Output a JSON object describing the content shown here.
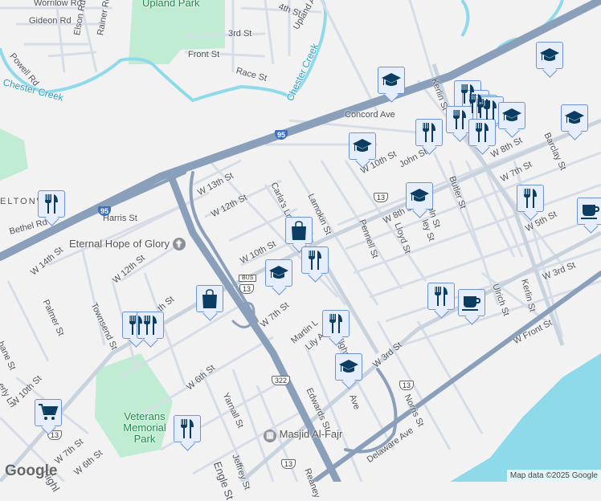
{
  "labels": {
    "worrilow": "Worrilow Rd",
    "gideon": "Gideon Rd",
    "elson": "Elson Rd",
    "rainer": "Rainer Rd",
    "powell": "Powell Rd",
    "upland_park": "Upland Park",
    "st4": "4th St",
    "upland_ave": "Upland Ave",
    "st3": "3rd St",
    "front": "Front St",
    "race": "Race St",
    "chester_creek_w": "Chester Creek",
    "chester_creek_e": "Chester Creek",
    "kerlin_n": "Kerlin St",
    "concord": "Concord Ave",
    "barclay": "Barclay St",
    "eltonw": "ELTONW",
    "bethel": "Bethel Rd",
    "harris": "Harris St",
    "w13": "W 13th St",
    "w12": "W 12th St",
    "carlas": "Carla's Ln",
    "lamokin": "Lamokin St",
    "w10": "W 10th St",
    "john": "John St",
    "w10b": "W 10th St",
    "lincoln": "Lincoln St",
    "butler": "Butler St",
    "w8": "W 8th St",
    "w7": "W 7th St",
    "w8b": "W 8th St",
    "pennell": "Pennell St",
    "lloyd": "Lloyd St",
    "ley": "ley St",
    "w5": "W 5th St",
    "kerlin_s": "Kerlin St",
    "w3": "W 3rd St",
    "ulrich": "Ulrich St",
    "w14": "W 14th St",
    "w12b": "W 12th St",
    "palmer": "Palmer St",
    "townsend": "Townsend St",
    "w9": "th St",
    "w7b": "W 7th St",
    "martin": "Martin L",
    "lily": "Lily A",
    "tilghman": "Tilghman St",
    "w3b": "W 3rd St",
    "edwards": "Edwards St",
    "ave": "Ave",
    "norris": "Norris St",
    "wfront": "W Front St",
    "w6": "W 6th St",
    "yarnall": "Yarnall St",
    "veterans": "Veterans Memorial Park",
    "jeffrey": "Jeffrey St",
    "engle": "Engle St",
    "reaney": "Reaney",
    "delaware": "Delaware Ave",
    "w10c": "W 10th St",
    "w7c": "W 7th St",
    "w6b": "W 6th St",
    "high": "Highl",
    "ely": "erly Ln",
    "shane": "hane St",
    "eternal": "Eternal Hope of Glory",
    "masjid": "Masjid Al-Fajr"
  },
  "shields": {
    "i95a": "95",
    "i95b": "95",
    "bus": "BUS",
    "us13a": "13",
    "us13b": "13",
    "us13c": "13",
    "us13d": "13",
    "us13e": "13",
    "us322": "322"
  },
  "attribution": "Map data ©2025 Google",
  "logo": "Google",
  "markers": [
    {
      "type": "restaurant"
    },
    {
      "type": "education"
    },
    {
      "type": "education"
    },
    {
      "type": "restaurant"
    },
    {
      "type": "restaurant"
    },
    {
      "type": "restaurant"
    },
    {
      "type": "restaurant"
    },
    {
      "type": "restaurant"
    },
    {
      "type": "restaurant"
    },
    {
      "type": "restaurant"
    },
    {
      "type": "education"
    },
    {
      "type": "education"
    },
    {
      "type": "education"
    },
    {
      "type": "education"
    },
    {
      "type": "restaurant"
    },
    {
      "type": "coffee"
    },
    {
      "type": "shopping"
    },
    {
      "type": "restaurant"
    },
    {
      "type": "education"
    },
    {
      "type": "shopping"
    },
    {
      "type": "restaurant"
    },
    {
      "type": "restaurant"
    },
    {
      "type": "restaurant"
    },
    {
      "type": "education"
    },
    {
      "type": "restaurant"
    },
    {
      "type": "coffee"
    },
    {
      "type": "shopping-cart"
    },
    {
      "type": "restaurant"
    }
  ],
  "colors": {
    "land": "#f3f2f3",
    "park": "#c0ecd3",
    "water": "#8fdaea",
    "highway": "#8aa0ba",
    "road": "#d6dde6",
    "marker_icon": "#0b3d62",
    "marker_bg": "#e6eefc"
  }
}
